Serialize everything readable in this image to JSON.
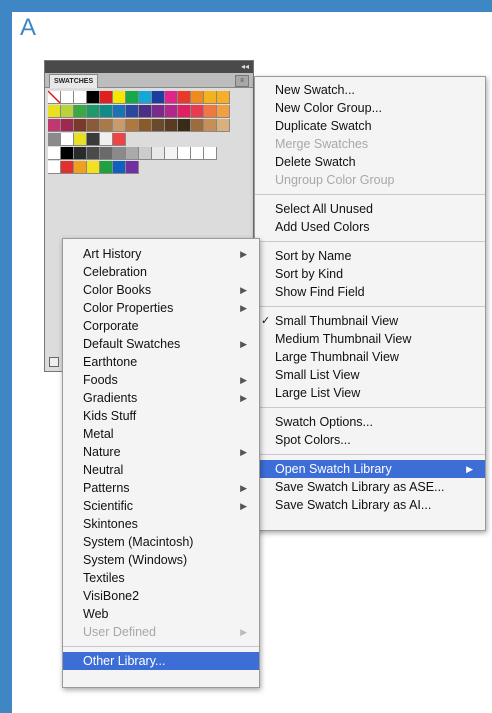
{
  "figure_label": "A",
  "panel": {
    "tab_label": "SWATCHES",
    "menu_button": "≡",
    "swatch_rows": [
      [
        "#ffffff",
        "#ffffff",
        "#ffffff",
        "#000000",
        "#e02020",
        "#f7e600",
        "#17a84a",
        "#12a8d8",
        "#1c3ea0",
        "#e0248c",
        "#e83a2a",
        "#f08a1c",
        "#f5b21c",
        "#f7b024"
      ],
      [
        "#e8e020",
        "#b8d43c",
        "#3aa846",
        "#1c9a6a",
        "#128a8a",
        "#1a72b8",
        "#2a48a0",
        "#4a2e88",
        "#7a2a8a",
        "#b0288a",
        "#e02060",
        "#e83a50",
        "#f07840",
        "#f0a040"
      ],
      [
        "#c03870",
        "#a02850",
        "#7a3a2a",
        "#8a5a3a",
        "#a87a4a",
        "#c89c6a",
        "#b07840",
        "#8a5a2a",
        "#6a4a2a",
        "#5a3a20",
        "#3a2a1a",
        "#9c6c3c",
        "#c49058",
        "#dab07c"
      ],
      [
        "#8a8a8a",
        "#ffffff",
        "#e8e020",
        "#3a3a3a",
        "#f0f0f0",
        "#e44"
      ],
      [
        "#ffffff",
        "#000000",
        "#2a2a2a",
        "#4a4a4a",
        "#6a6a6a",
        "#8a8a8a",
        "#aaaaaa",
        "#cccccc",
        "#e8e8e8",
        "#f4f4f4",
        "#ffffff",
        "#ffffff",
        "#ffffff"
      ],
      [
        "#ffffff",
        "#e03030",
        "#f0a020",
        "#f5e020",
        "#20a040",
        "#1060c0",
        "#7030a0"
      ]
    ]
  },
  "right_menu": {
    "group1": [
      {
        "label": "New Swatch...",
        "disabled": false
      },
      {
        "label": "New Color Group...",
        "disabled": false
      },
      {
        "label": "Duplicate Swatch",
        "disabled": false
      },
      {
        "label": "Merge Swatches",
        "disabled": true
      },
      {
        "label": "Delete Swatch",
        "disabled": false
      },
      {
        "label": "Ungroup Color Group",
        "disabled": true
      }
    ],
    "group2": [
      {
        "label": "Select All Unused"
      },
      {
        "label": "Add Used Colors"
      }
    ],
    "group3": [
      {
        "label": "Sort by Name"
      },
      {
        "label": "Sort by Kind"
      },
      {
        "label": "Show Find Field"
      }
    ],
    "group4": [
      {
        "label": "Small Thumbnail View",
        "checked": true
      },
      {
        "label": "Medium Thumbnail View",
        "checked": false
      },
      {
        "label": "Large Thumbnail View",
        "checked": false
      },
      {
        "label": "Small List View",
        "checked": false
      },
      {
        "label": "Large List View",
        "checked": false
      }
    ],
    "group5": [
      {
        "label": "Swatch Options..."
      },
      {
        "label": "Spot Colors..."
      }
    ],
    "group6": [
      {
        "label": "Open Swatch Library",
        "highlight": true,
        "submenu": true
      },
      {
        "label": "Save Swatch Library as ASE..."
      },
      {
        "label": "Save Swatch Library as AI..."
      }
    ],
    "check_glyph": "✓",
    "arrow_glyph": "▶"
  },
  "library_menu": {
    "items": [
      {
        "label": "Art History",
        "submenu": true
      },
      {
        "label": "Celebration"
      },
      {
        "label": "Color Books",
        "submenu": true
      },
      {
        "label": "Color Properties",
        "submenu": true
      },
      {
        "label": "Corporate"
      },
      {
        "label": "Default Swatches",
        "submenu": true
      },
      {
        "label": "Earthtone"
      },
      {
        "label": "Foods",
        "submenu": true
      },
      {
        "label": "Gradients",
        "submenu": true
      },
      {
        "label": "Kids Stuff"
      },
      {
        "label": "Metal"
      },
      {
        "label": "Nature",
        "submenu": true
      },
      {
        "label": "Neutral"
      },
      {
        "label": "Patterns",
        "submenu": true
      },
      {
        "label": "Scientific",
        "submenu": true
      },
      {
        "label": "Skintones"
      },
      {
        "label": "System (Macintosh)"
      },
      {
        "label": "System (Windows)"
      },
      {
        "label": "Textiles"
      },
      {
        "label": "VisiBone2"
      },
      {
        "label": "Web"
      },
      {
        "label": "User Defined",
        "submenu": true,
        "disabled": true
      }
    ],
    "footer_item": {
      "label": "Other Library...",
      "highlight": true
    },
    "arrow_glyph": "▶"
  }
}
